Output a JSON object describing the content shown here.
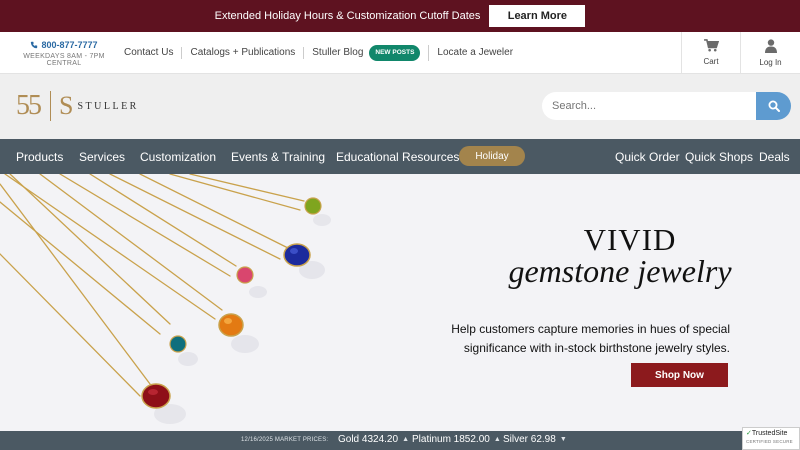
{
  "announcement": {
    "text": "Extended Holiday Hours & Customization Cutoff Dates",
    "button_label": "Learn More"
  },
  "utility": {
    "phone": "800-877-7777",
    "hours": "WEEKDAYS 8AM - 7PM CENTRAL",
    "links": [
      "Contact Us",
      "Catalogs + Publications",
      "Stuller Blog",
      "Locate a Jeweler"
    ],
    "blog_badge": "NEW POSTS",
    "cart_label": "Cart",
    "login_label": "Log In"
  },
  "logo": {
    "mark": "55",
    "s": "S",
    "word": "STULLER"
  },
  "search": {
    "placeholder": "Search..."
  },
  "nav": {
    "left": [
      "Products",
      "Services",
      "Customization",
      "Events & Training",
      "Educational Resources"
    ],
    "holiday_label": "Holiday",
    "right": [
      "Quick Order",
      "Quick Shops",
      "Deals"
    ]
  },
  "hero": {
    "title_line1": "VIVID",
    "title_line2": "gemstone jewelry",
    "subtitle_line1": "Help customers capture memories in hues of special",
    "subtitle_line2": "significance with in-stock birthstone jewelry styles.",
    "cta_label": "Shop Now"
  },
  "market": {
    "date_label": "12/16/2025 MARKET PRICES:",
    "metals": [
      {
        "label": "Gold 4324.20",
        "direction": "up"
      },
      {
        "label": "Platinum 1852.00",
        "direction": "up"
      },
      {
        "label": "Silver 62.98",
        "direction": "down"
      }
    ]
  },
  "trusted": {
    "title": "TrustedSite",
    "subtitle": "CERTIFIED SECURE"
  },
  "colors": {
    "announcement_bg": "#5e1220",
    "nav_bg": "#4b5963",
    "holiday_pill": "#a3844c",
    "search_button": "#5e9bd0",
    "shop_now": "#8c1a1d",
    "badge_new": "#11876b",
    "gold_accent": "#b08d55"
  },
  "icons": {
    "phone": "phone-icon",
    "cart": "cart-icon",
    "user": "user-icon",
    "search": "search-icon"
  }
}
